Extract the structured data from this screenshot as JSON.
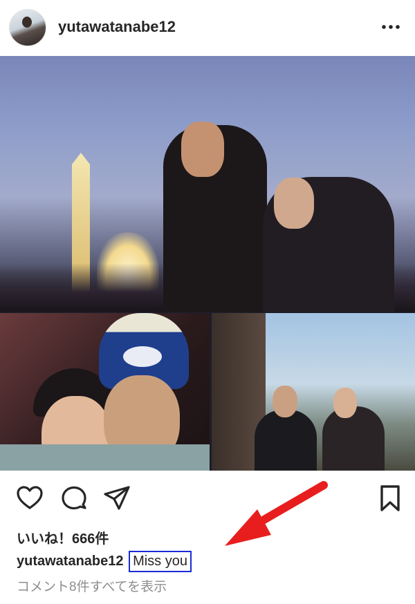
{
  "post": {
    "username": "yutawatanabe12",
    "likes_text": "いいね！666件",
    "caption_username": "yutawatanabe12",
    "caption_text": "Miss you",
    "view_comments": "コメント8件すべてを表示"
  },
  "icons": {
    "more": "more-horizontal-icon",
    "like": "heart-icon",
    "comment": "comment-bubble-icon",
    "share": "send-paper-plane-icon",
    "save": "bookmark-icon"
  },
  "colors": {
    "text": "#262626",
    "muted": "#8e8e8e",
    "highlight_box": "#1a2ad6",
    "annotation_arrow": "#e81e1e"
  }
}
